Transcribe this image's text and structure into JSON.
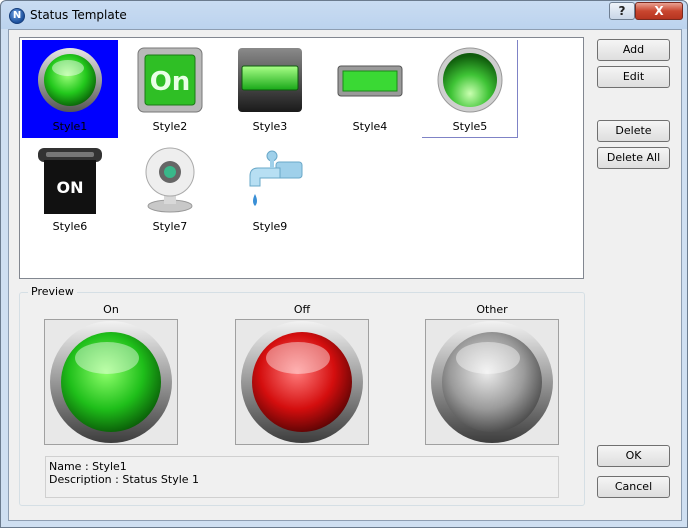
{
  "window": {
    "title": "Status Template",
    "help_label": "?",
    "close_label": "X"
  },
  "styles": [
    {
      "label": "Style1",
      "icon": "green-round-button-icon"
    },
    {
      "label": "Style2",
      "icon": "green-on-tile-icon"
    },
    {
      "label": "Style3",
      "icon": "green-bar-panel-icon"
    },
    {
      "label": "Style4",
      "icon": "green-bar-icon"
    },
    {
      "label": "Style5",
      "icon": "green-glow-button-icon"
    },
    {
      "label": "Style6",
      "icon": "black-on-switch-icon"
    },
    {
      "label": "Style7",
      "icon": "webcam-icon"
    },
    {
      "label": "Style9",
      "icon": "water-faucet-icon"
    }
  ],
  "buttons": {
    "add": "Add",
    "edit": "Edit",
    "delete": "Delete",
    "delete_all": "Delete All",
    "ok": "OK",
    "cancel": "Cancel"
  },
  "preview": {
    "title": "Preview",
    "on": "On",
    "off": "Off",
    "other": "Other",
    "name_line": "Name : Style1",
    "description_line": "Description  : Status Style 1"
  },
  "colors": {
    "selection": "#0000ff",
    "on": "#22cc22",
    "off": "#dd1111",
    "other": "#9a9a9a"
  }
}
